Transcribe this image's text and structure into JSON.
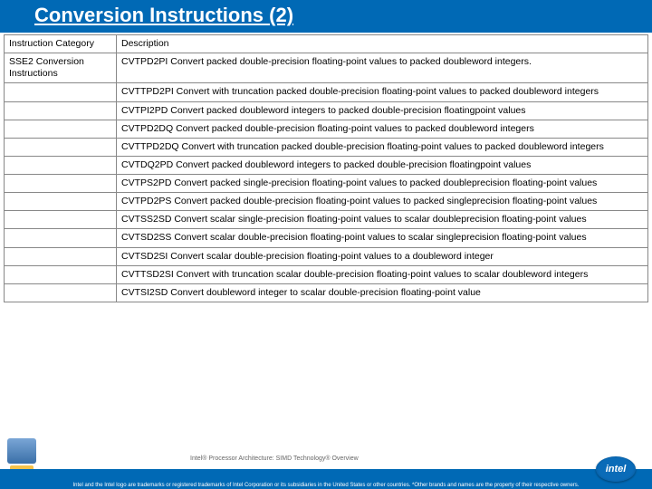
{
  "title": "Conversion Instructions (2)",
  "table": {
    "headers": {
      "col1": "Instruction Category",
      "col2": "Description"
    },
    "category": "SSE2 Conversion Instructions",
    "rows": [
      "CVTPD2PI Convert packed double-precision floating-point values to packed doubleword integers.",
      "CVTTPD2PI Convert with truncation packed double-precision floating-point values to packed doubleword integers",
      "CVTPI2PD Convert packed doubleword integers to packed double-precision floatingpoint values",
      "CVTPD2DQ Convert packed double-precision floating-point values to packed doubleword integers",
      "CVTTPD2DQ Convert with truncation packed double-precision floating-point values to packed doubleword integers",
      "CVTDQ2PD Convert packed doubleword integers to packed double-precision floatingpoint values",
      "CVTPS2PD Convert packed single-precision floating-point values to packed doubleprecision floating-point values",
      "CVTPD2PS Convert packed double-precision floating-point values to packed singleprecision floating-point values",
      "CVTSS2SD Convert scalar single-precision floating-point values to scalar doubleprecision floating-point values",
      "CVTSD2SS Convert scalar double-precision floating-point values to scalar singleprecision floating-point values",
      "CVTSD2SI Convert scalar double-precision floating-point values to a doubleword integer",
      "CVTTSD2SI Convert with truncation scalar double-precision floating-point values to scalar doubleword integers",
      "CVTSI2SD Convert doubleword integer to scalar double-precision floating-point value"
    ]
  },
  "midnote": "Intel® Processor Architecture: SIMD Technology® Overview",
  "legal": "Intel and the Intel logo are trademarks or registered trademarks of Intel Corporation or its subsidiaries in the United States or other countries. *Other brands and names are the property of their respective owners.",
  "logo_text": "intel"
}
